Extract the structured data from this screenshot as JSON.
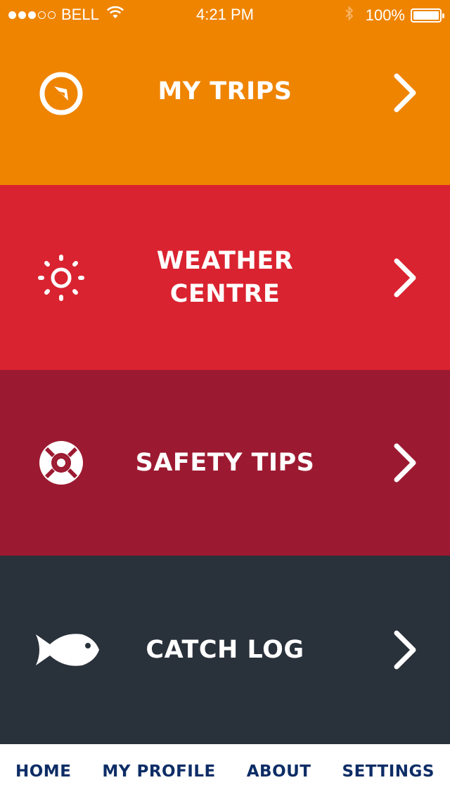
{
  "status_bar": {
    "carrier": "BELL",
    "time": "4:21 PM",
    "battery": "100%",
    "signal_bars_filled": 3,
    "signal_bars_total": 5
  },
  "menu": {
    "items": [
      {
        "label": "MY TRIPS",
        "icon": "compass-icon",
        "color": "#ef8400"
      },
      {
        "label": "WEATHER\nCENTRE",
        "icon": "sun-icon",
        "color": "#da2330"
      },
      {
        "label": "SAFETY TIPS",
        "icon": "life-ring-icon",
        "color": "#9c1a31"
      },
      {
        "label": "CATCH LOG",
        "icon": "fish-icon",
        "color": "#29313b"
      }
    ]
  },
  "tab_bar": {
    "items": [
      {
        "label": "HOME"
      },
      {
        "label": "MY PROFILE"
      },
      {
        "label": "ABOUT"
      },
      {
        "label": "SETTINGS"
      }
    ],
    "text_color": "#0d2d66"
  }
}
